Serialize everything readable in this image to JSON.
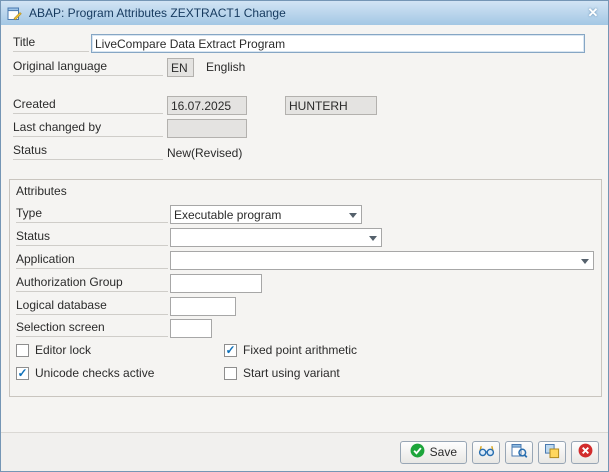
{
  "window": {
    "title": "ABAP: Program Attributes ZEXTRACT1 Change",
    "close_glyph": "✕"
  },
  "fields": {
    "title": {
      "label": "Title",
      "value": "LiveCompare Data Extract Program"
    },
    "orig_lang": {
      "label": "Original language",
      "code": "EN",
      "name": "English"
    },
    "created": {
      "label": "Created",
      "date": "16.07.2025",
      "user": "HUNTERH"
    },
    "last_changed": {
      "label": "Last changed by",
      "value": ""
    },
    "status": {
      "label": "Status",
      "value": "New(Revised)"
    }
  },
  "attributes": {
    "group_title": "Attributes",
    "type": {
      "label": "Type",
      "value": "Executable program"
    },
    "status": {
      "label": "Status",
      "value": ""
    },
    "application": {
      "label": "Application",
      "value": ""
    },
    "auth_group": {
      "label": "Authorization Group",
      "value": ""
    },
    "logical_db": {
      "label": "Logical database",
      "value": ""
    },
    "selection_screen": {
      "label": "Selection screen",
      "value": ""
    },
    "checkboxes": [
      {
        "label": "Editor lock",
        "mark": ""
      },
      {
        "label": "Fixed point arithmetic",
        "mark": "✓"
      },
      {
        "label": "Unicode checks active",
        "mark": "✓"
      },
      {
        "label": "Start using variant",
        "mark": ""
      }
    ]
  },
  "footer": {
    "save_label": "Save"
  },
  "colors": {
    "titlebar_top": "#d2e4f4",
    "titlebar_bottom": "#a3c7e4",
    "body_bg": "#f5f4f2",
    "readonly_bg": "#e4e3e1",
    "check_color": "#1071b9",
    "save_green": "#1da53b",
    "cancel_red": "#d22c2c"
  }
}
